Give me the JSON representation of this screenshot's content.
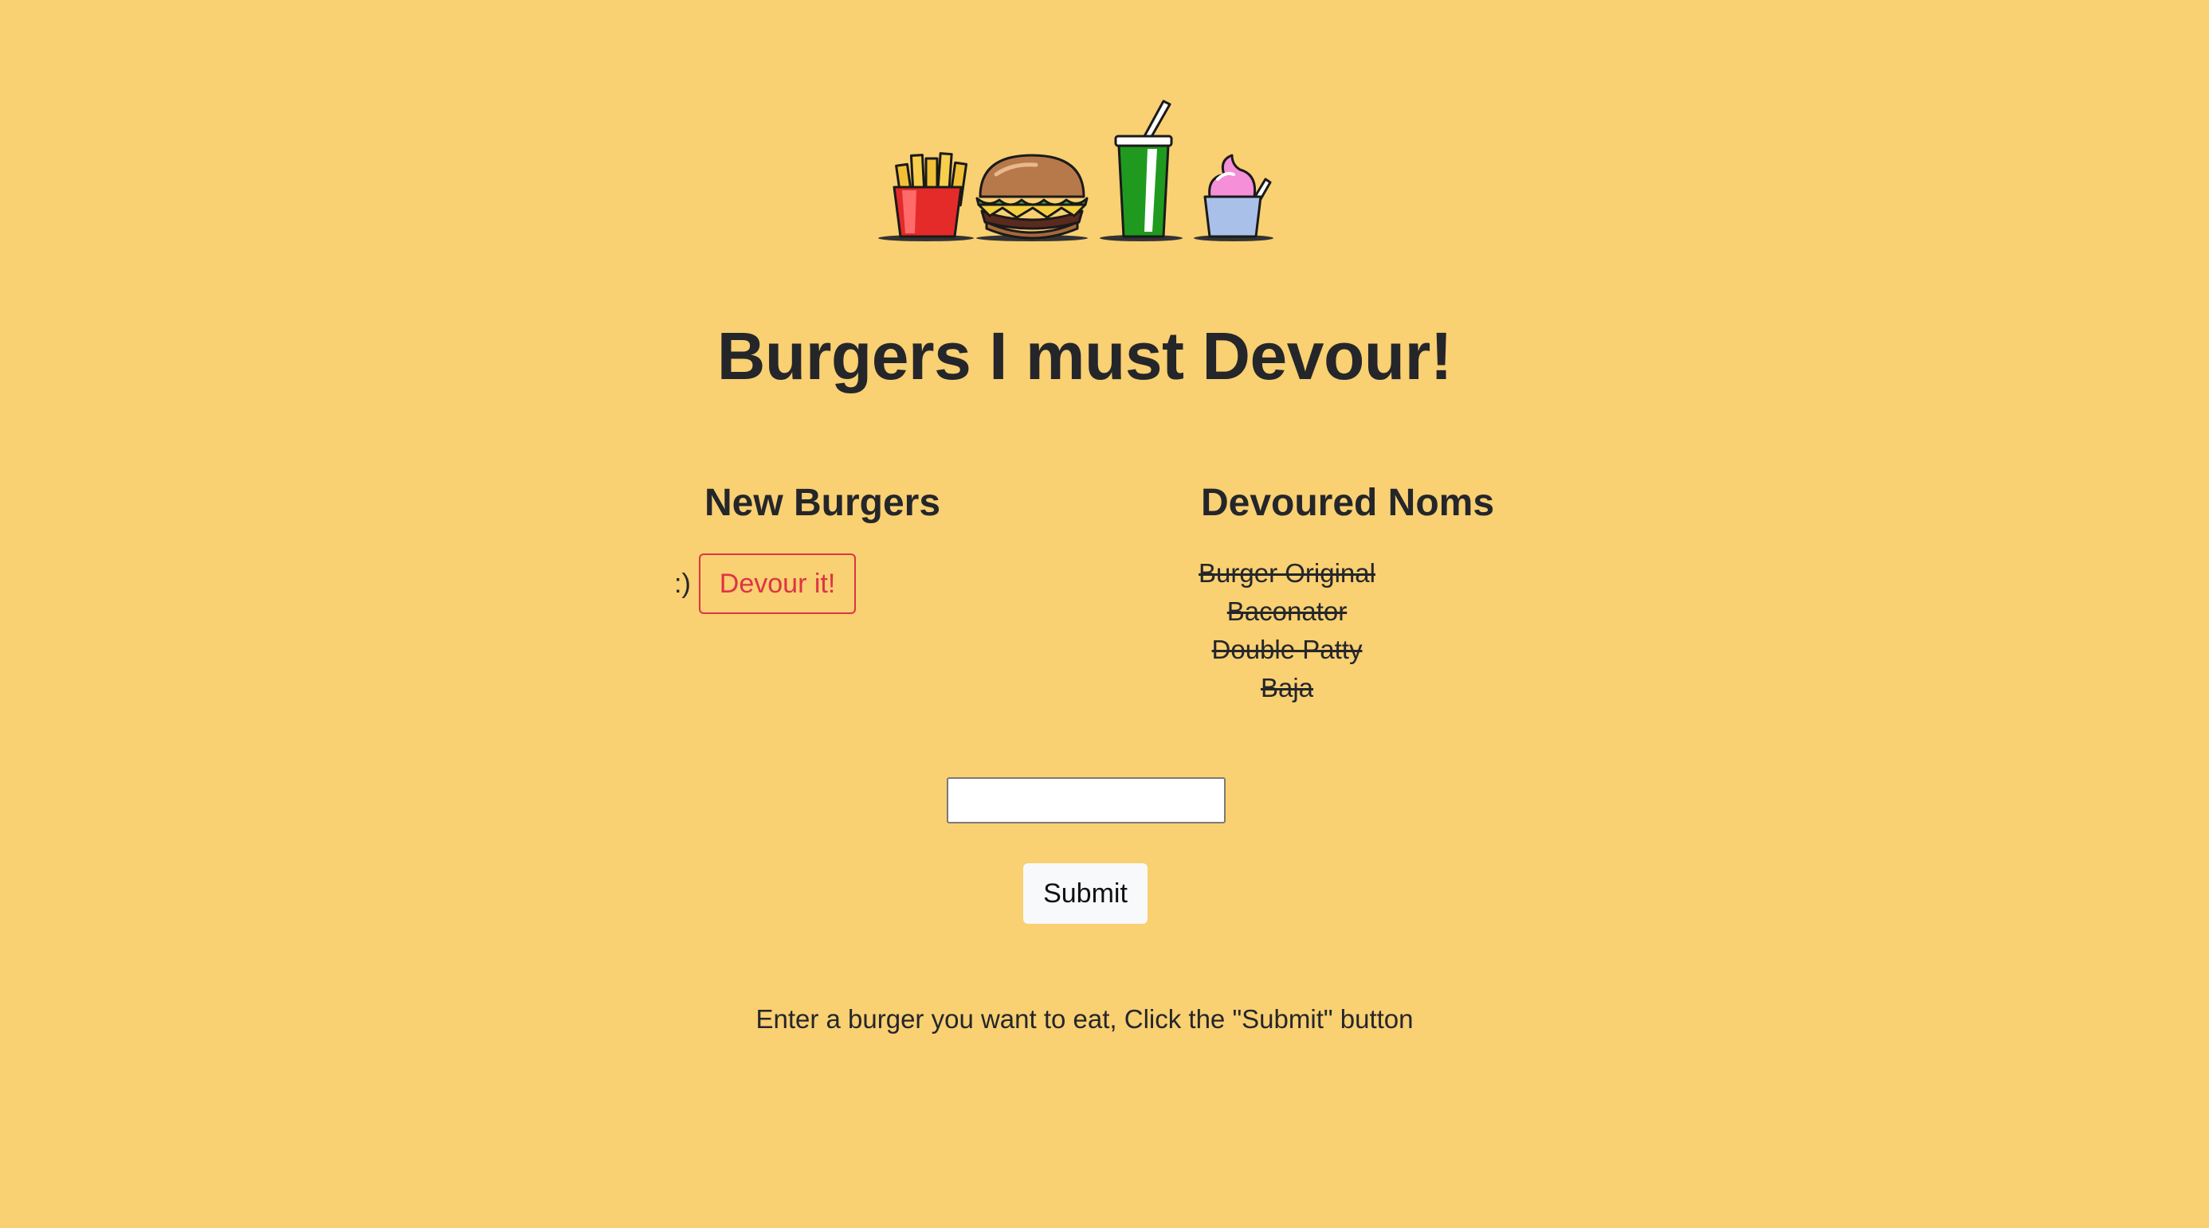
{
  "hero": {
    "icons": [
      "fries-icon",
      "burger-icon",
      "soda-cup-icon",
      "ice-cream-icon"
    ]
  },
  "title": "Burgers I must Devour!",
  "new_burgers": {
    "heading": "New Burgers",
    "items": [
      {
        "name": ":)",
        "button_label": "Devour it!"
      }
    ]
  },
  "devoured": {
    "heading": "Devoured Noms",
    "items": [
      "Burger Original",
      "Baconator",
      "Double Patty",
      "Baja"
    ]
  },
  "form": {
    "input_value": "",
    "input_placeholder": "",
    "submit_label": "Submit"
  },
  "instructions": "Enter a burger you want to eat, Click the \"Submit\" button",
  "colors": {
    "background": "#F9D072",
    "devour_button": "#dc3545",
    "text": "#24262a"
  }
}
